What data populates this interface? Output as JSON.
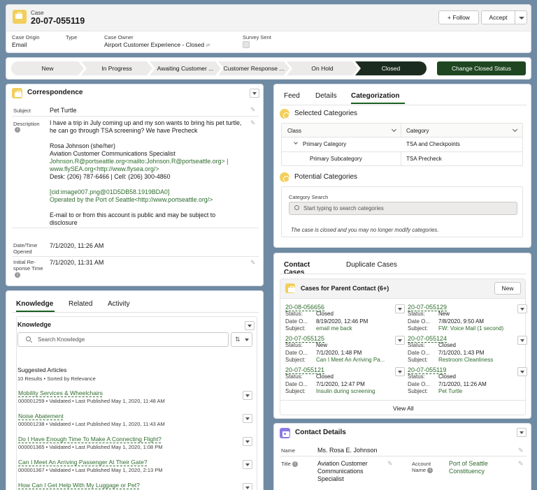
{
  "header": {
    "object_label": "Case",
    "case_number": "20-07-055119",
    "follow_label": "Follow",
    "accept_label": "Accept",
    "fields": [
      {
        "label": "Case Origin",
        "value": "Email"
      },
      {
        "label": "Type",
        "value": ""
      },
      {
        "label": "Case Owner",
        "value": "Airport Customer Experience - Closed"
      },
      {
        "label": "Survey Sent",
        "value": ""
      }
    ]
  },
  "path": {
    "steps": [
      "New",
      "In Progress",
      "Awaiting Customer ...",
      "Customer Response ...",
      "On Hold",
      "Closed"
    ],
    "current": "Closed",
    "change_button": "Change Closed Status"
  },
  "correspondence": {
    "title": "Correspondence",
    "subject_label": "Subject",
    "subject_value": "Pet Turtle",
    "description_label": "Description",
    "description_lines": [
      "I have a trip in July coming up and my son wants to bring his pet turtle,",
      "he can go through TSA screening? We have Precheck",
      "",
      "Rosa Johnson (she/her)",
      "Aviation Customer Communications Specialist",
      "Johnson.R@portseattle.org<mailto:Johnson.R@portseattle.org> |",
      "www.flySEA.org<http://www.flysea.org/>",
      "Desk: (206) 787-6466 | Cell: (206) 300-4860",
      "",
      "[cid:image007.png@01D5DB58.1919BDA0]",
      "Operated by the Port of Seattle<http://www.portseattle.org/>",
      "",
      "E-mail to or from this account is public and may be subject to",
      "disclosure"
    ],
    "opened_label_1": "Date/Time",
    "opened_label_2": "Opened",
    "opened_value": "7/1/2020, 11:26 AM",
    "response_label_1": "Initial Re-",
    "response_label_2": "sponse Time",
    "response_value": "7/1/2020, 11:31 AM"
  },
  "knowledge_panel": {
    "tabs": [
      "Knowledge",
      "Related",
      "Activity"
    ],
    "title": "Knowledge",
    "search_placeholder": "Search Knowledge",
    "suggested_label": "Suggested Articles",
    "results_label": "10 Results • Sorted by Relevance",
    "articles": [
      {
        "title": "Mobility Services & Wheelchairs",
        "meta": "000001259  •  Validated  •  Last Published  May 1, 2020, 11:48 AM"
      },
      {
        "title": "Noise Abatement",
        "meta": "000001238  •  Validated  •  Last Published  May 1, 2020, 11:43 AM"
      },
      {
        "title": "Do I Have Enough Time To Make A Connecting Flight?",
        "meta": "000001365  •  Validated  •  Last Published  May 1, 2020, 1:08 PM"
      },
      {
        "title": "Can I Meet An Arriving Passenger At Their Gate?",
        "meta": "000001367  •  Validated  •  Last Published  May 1, 2020, 2:13 PM"
      },
      {
        "title": "How Can I Get Help With My Luggage or Pet?",
        "meta": ""
      }
    ]
  },
  "categorization": {
    "tabs": [
      "Feed",
      "Details",
      "Categorization"
    ],
    "selected_title": "Selected Categories",
    "col_class": "Class",
    "col_category": "Category",
    "rows": [
      {
        "class": "Primary Category",
        "category": "TSA and Checkpoints"
      },
      {
        "class": "Primary Subcategory",
        "category": "TSA Precheck"
      }
    ],
    "potential_title": "Potential Categories",
    "search_label": "Category Search",
    "search_placeholder": "Start typing to search categories",
    "closed_note": "The case is closed and you may no longer modify categories."
  },
  "contact_cases": {
    "tabs": [
      "Contact Cases",
      "Duplicate Cases"
    ],
    "title": "Cases for Parent Contact (6+)",
    "new_label": "New",
    "status_label": "Status:",
    "date_label": "Date O...",
    "subject_label": "Subject:",
    "cases": [
      {
        "number": "20-08-056656",
        "status": "Closed",
        "date": "8/19/2020, 12:46 PM",
        "subject": "email me back"
      },
      {
        "number": "20-07-055129",
        "status": "New",
        "date": "7/8/2020, 9:50 AM",
        "subject": "FW: Voice Mail (1 second)"
      },
      {
        "number": "20-07-055125",
        "status": "New",
        "date": "7/1/2020, 1:48 PM",
        "subject": "Can I Meet An Arriving Pa..."
      },
      {
        "number": "20-07-055124",
        "status": "Closed",
        "date": "7/1/2020, 1:43 PM",
        "subject": "Restroom Cleanliness"
      },
      {
        "number": "20-07-055121",
        "status": "Closed",
        "date": "7/1/2020, 12:47 PM",
        "subject": "Insulin during screening"
      },
      {
        "number": "20-07-055119",
        "status": "Closed",
        "date": "7/1/2020, 11:26 AM",
        "subject": "Pet Turtle"
      }
    ],
    "view_all": "View All"
  },
  "contact_details": {
    "title": "Contact Details",
    "name_label": "Name",
    "name_value": "Ms. Rosa E. Johnson",
    "title_label": "Title",
    "title_value_lines": [
      "Aviation Customer",
      "Communications",
      "Specialist"
    ],
    "account_label_1": "Account",
    "account_label_2": "Name",
    "account_value_lines": [
      "Port of Seattle",
      "Constituency"
    ]
  }
}
